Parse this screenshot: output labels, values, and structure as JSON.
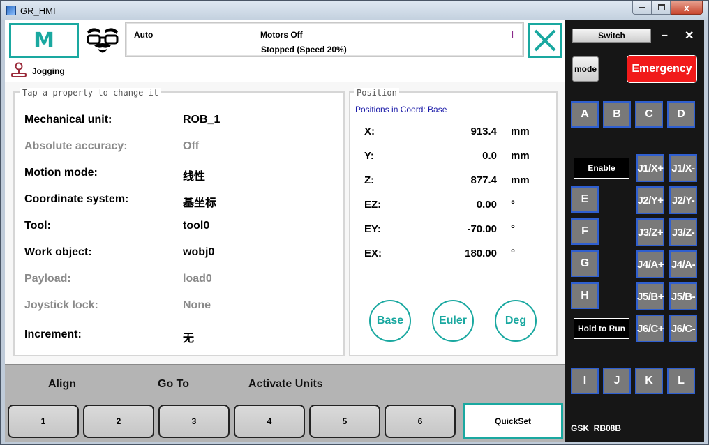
{
  "window": {
    "title": "GR_HMI",
    "close_glyph": "x"
  },
  "header": {
    "mode_logo": "M",
    "status": {
      "mode": "Auto",
      "motors": "Motors Off",
      "state": "Stopped (Speed 20%)"
    },
    "status_icon": "I",
    "close_icon": "close-x-icon"
  },
  "jogging": {
    "label": "Jogging"
  },
  "properties": {
    "title": "Tap a property to change it",
    "rows": [
      {
        "name": "Mechanical unit:",
        "value": "ROB_1",
        "enabled": true
      },
      {
        "name": "Absolute accuracy:",
        "value": "Off",
        "enabled": false
      },
      {
        "name": "Motion mode:",
        "value": "线性",
        "enabled": true
      },
      {
        "name": "Coordinate system:",
        "value": "基坐标",
        "enabled": true
      },
      {
        "name": "Tool:",
        "value": "tool0",
        "enabled": true
      },
      {
        "name": "Work object:",
        "value": "wobj0",
        "enabled": true
      },
      {
        "name": "Payload:",
        "value": "load0",
        "enabled": false
      },
      {
        "name": "Joystick lock:",
        "value": "None",
        "enabled": false
      },
      {
        "name": "Increment:",
        "value": "无",
        "enabled": true
      }
    ]
  },
  "position": {
    "title": "Position",
    "subtitle": "Positions in Coord: Base",
    "rows": [
      {
        "axis": "X:",
        "value": "913.4",
        "unit": "mm"
      },
      {
        "axis": "Y:",
        "value": "0.0",
        "unit": "mm"
      },
      {
        "axis": "Z:",
        "value": "877.4",
        "unit": "mm"
      },
      {
        "axis": "EZ:",
        "value": "0.00",
        "unit": "°"
      },
      {
        "axis": "EY:",
        "value": "-70.00",
        "unit": "°"
      },
      {
        "axis": "EX:",
        "value": "180.00",
        "unit": "°"
      }
    ],
    "buttons": [
      "Base",
      "Euler",
      "Deg"
    ]
  },
  "actions": [
    "Align",
    "Go To",
    "Activate Units"
  ],
  "tabs": [
    "1",
    "2",
    "3",
    "4",
    "5",
    "6",
    "QuickSet"
  ],
  "right_panel": {
    "switch": "Switch",
    "minimize": "–",
    "close": "✕",
    "mode": "mode",
    "emergency": "Emergency",
    "top_keys": [
      "A",
      "B",
      "C",
      "D"
    ],
    "enable": "Enable",
    "hold_to_run": "Hold to Run",
    "side_keys": [
      "E",
      "F",
      "G",
      "H"
    ],
    "jog_plus": [
      "J1/X+",
      "J2/Y+",
      "J3/Z+",
      "J4/A+",
      "J5/B+",
      "J6/C+"
    ],
    "jog_minus": [
      "J1/X-",
      "J2/Y-",
      "J3/Z-",
      "J4/A-",
      "J5/B-",
      "J6/C-"
    ],
    "bottom_keys": [
      "I",
      "J",
      "K",
      "L"
    ],
    "model": "GSK_RB08B"
  },
  "colors": {
    "accent": "#1aa8a0",
    "emergency": "#f11a1a",
    "key_border": "#2f5fd0",
    "key_fill": "#797979"
  }
}
